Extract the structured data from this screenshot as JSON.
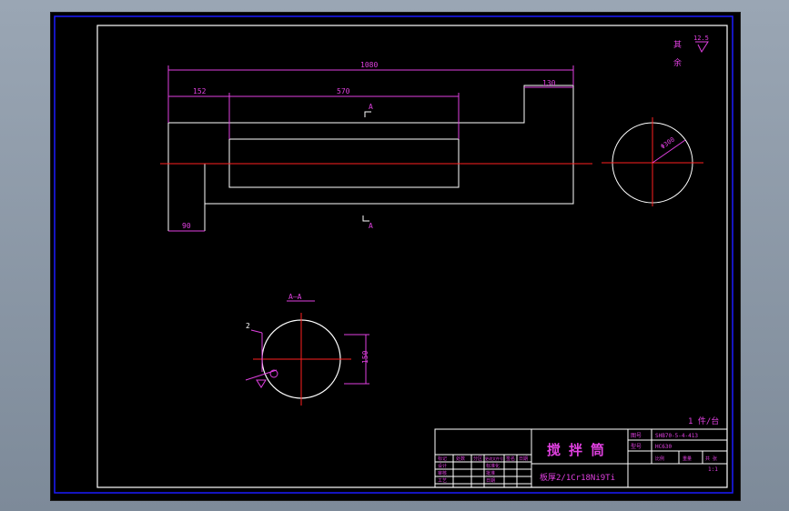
{
  "colors": {
    "background": "#000000",
    "outline": "#ffffff",
    "dimension": "#e040e0",
    "centerline": "#ff2020",
    "border": "#1a1aff"
  },
  "dimensions": {
    "overall_length": "1080",
    "left_segment": "152",
    "middle_segment": "570",
    "right_segment": "130",
    "bottom_left": "90",
    "circle_diameter": "Φ300",
    "section_height": "150",
    "chamfer": "2"
  },
  "labels": {
    "section_mark_top": "A",
    "section_mark_bottom": "A",
    "section_title": "A—A",
    "roughness_value": "12.5",
    "roughness_note_1": "其",
    "roughness_note_2": "余",
    "quantity": "1 件/台"
  },
  "title_block": {
    "part_name": "搅 拌 筒",
    "material": "板厚2/1Cr18Ni9Ti",
    "drawing_number_label": "图号",
    "drawing_number": "SHB70-5-4-413",
    "product_label": "型号",
    "product_model": "HC630",
    "scale_label": "比例",
    "weight_label": "重量",
    "sheet_label": "共  张",
    "scale_value": "1:1",
    "rev_labels": [
      "标记",
      "处数",
      "分区",
      "更改文件号",
      "签名",
      "日期"
    ],
    "role_labels": [
      "设计",
      "审核",
      "工艺"
    ],
    "role_labels_2": [
      "标准化",
      "批准",
      "日期"
    ]
  }
}
